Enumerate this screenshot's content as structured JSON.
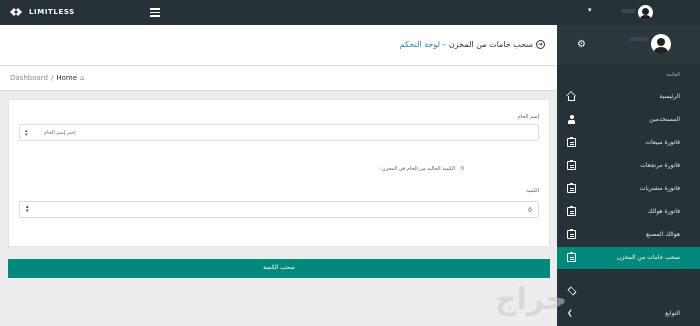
{
  "navbar": {
    "brand": "LIMITLESS",
    "user_caret": "▾"
  },
  "header": {
    "title_main": "سحب خامات من المخزن",
    "title_sep": "-",
    "title_sub": "لوحة التحكم"
  },
  "breadcrumb": {
    "root": "Dashboard",
    "sep": "/",
    "current": "Home"
  },
  "form": {
    "product_label": "إسم الخام",
    "product_placeholder": "إختر إسم الخام",
    "stock_label": "الكمية الحالية من الخام في المخزن :",
    "stock_value": "0",
    "qty_label": "الكمية",
    "qty_value": "0",
    "submit_label": "سحب الكمية"
  },
  "sidebar": {
    "heading": "القائمة",
    "items": [
      {
        "label": "الرئيسية",
        "icon": "home-icon"
      },
      {
        "label": "المستخدمين",
        "icon": "user-icon"
      },
      {
        "label": "فاتورة مبيعات",
        "icon": "clipboard-icon"
      },
      {
        "label": "فاتورة مرتجعات",
        "icon": "clipboard-icon"
      },
      {
        "label": "فاتورة مشتريات",
        "icon": "clipboard-icon"
      },
      {
        "label": "فاتورة هوالك",
        "icon": "clipboard-icon"
      },
      {
        "label": "هوالك المصنع",
        "icon": "clipboard-icon"
      },
      {
        "label": "سحب خامات من المخزن",
        "icon": "clipboard-icon",
        "active": true
      },
      {
        "label": "",
        "icon": "layers-icon"
      },
      {
        "label": "التوابع",
        "icon": "chevron-icon"
      }
    ]
  },
  "colors": {
    "navbar": "#263238",
    "accent": "#00897b",
    "link": "#2c7bb6"
  },
  "watermark": "حراج"
}
